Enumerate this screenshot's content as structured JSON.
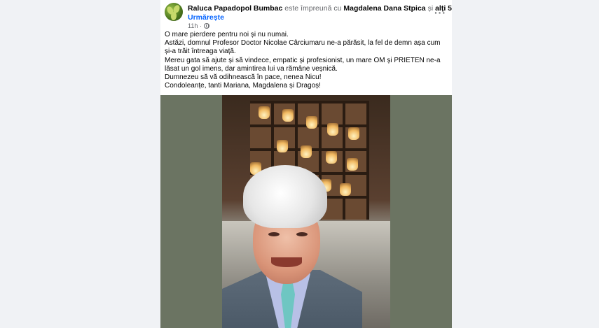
{
  "post": {
    "author": "Raluca Papadopol Bumbac",
    "with_text": "este împreună cu",
    "tagged": "Magdalena Dana Stpica",
    "and_text": "și",
    "others": "alți 5",
    "sep": ". ·",
    "follow_label": "Urmărește",
    "time": "11h ·",
    "more_icon": "more-horizontal-icon",
    "lines": [
      "O mare pierdere pentru noi și nu numai.",
      "Astăzi, domnul Profesor Doctor Nicolae Cârciumaru ne-a părăsit, la fel de demn așa cum și-a trăit întreaga viață.",
      "Mereu gata să ajute și să vindece, empatic și profesionist, un mare OM și PRIETEN ne-a lăsat un gol imens, dar amintirea lui va rămâne veșnică.",
      "Dumnezeu să vă odihnească în pace, nenea Nicu!",
      "Condoleanțe, tanti Mariana, Magdalena și Dragoș!"
    ]
  },
  "colors": {
    "link": "#0866ff",
    "text": "#050505",
    "secondary": "#65676b",
    "background": "#f0f2f5"
  }
}
